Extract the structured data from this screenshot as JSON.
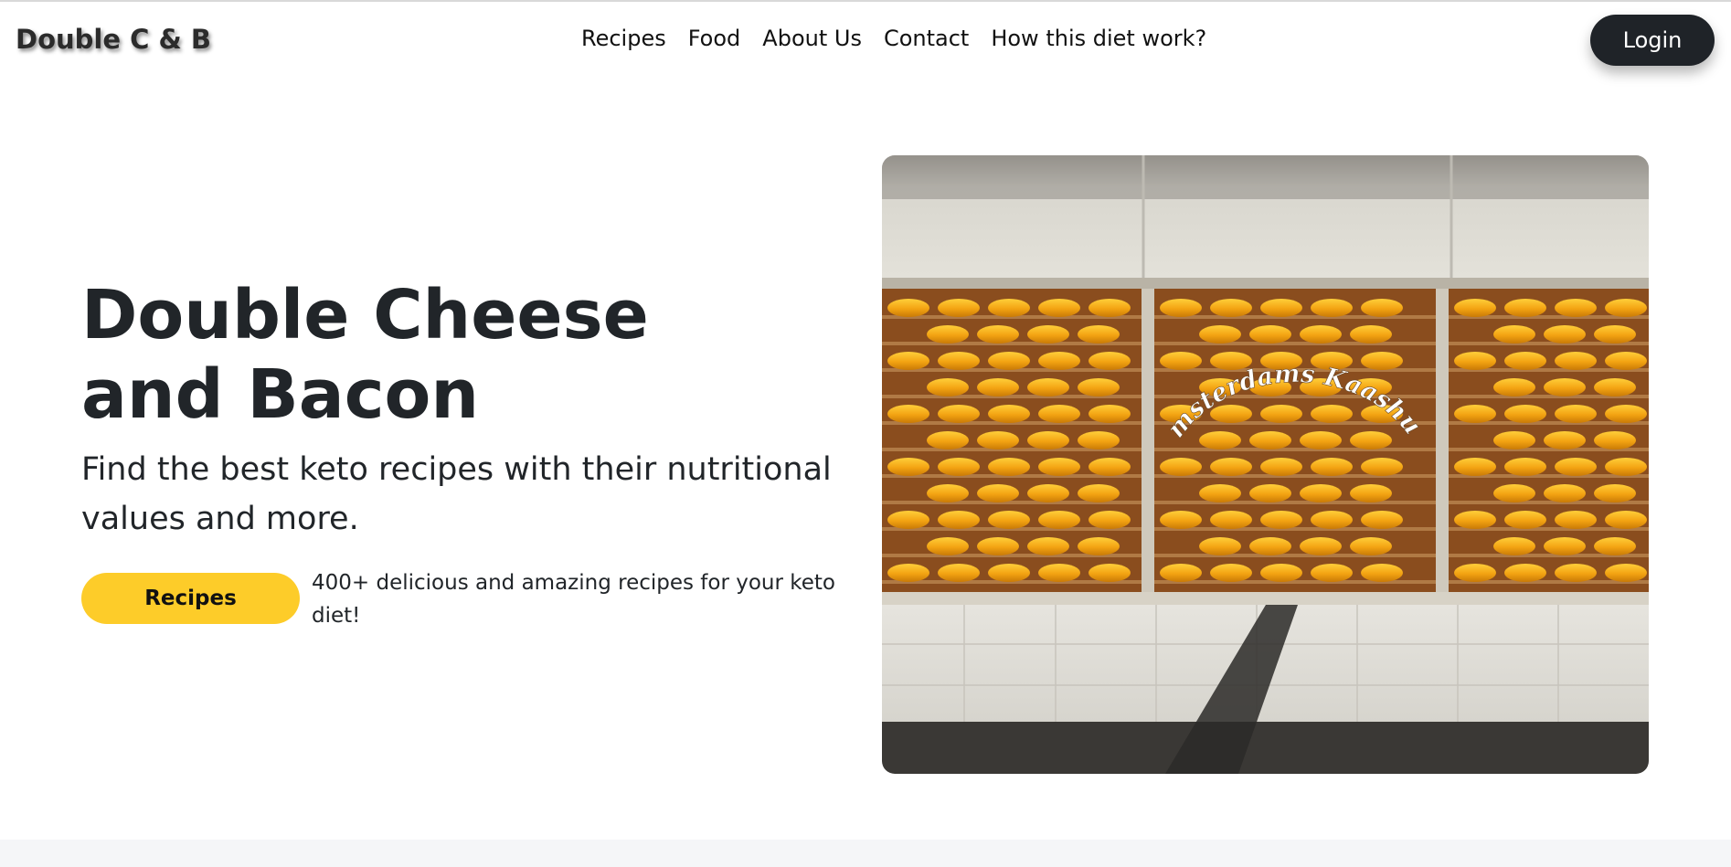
{
  "brand": {
    "name": "Double  C  &  B"
  },
  "nav": {
    "items": [
      {
        "label": "Recipes"
      },
      {
        "label": "Food"
      },
      {
        "label": "About Us"
      },
      {
        "label": "Contact"
      },
      {
        "label": "How this diet work?"
      }
    ],
    "login_label": "Login"
  },
  "hero": {
    "title_line1": "Double Cheese",
    "title_line2": "and Bacon",
    "subtitle": "Find the best keto recipes with their nutritional values and more.",
    "cta_label": "Recipes",
    "cta_note": "400+ delicious and amazing recipes for your keto diet!",
    "image_sign_text": "Amsterdams Kaashuis"
  },
  "colors": {
    "accent_yellow": "#fdcc29",
    "dark": "#1f2328",
    "cheese": "#f2a71a"
  }
}
